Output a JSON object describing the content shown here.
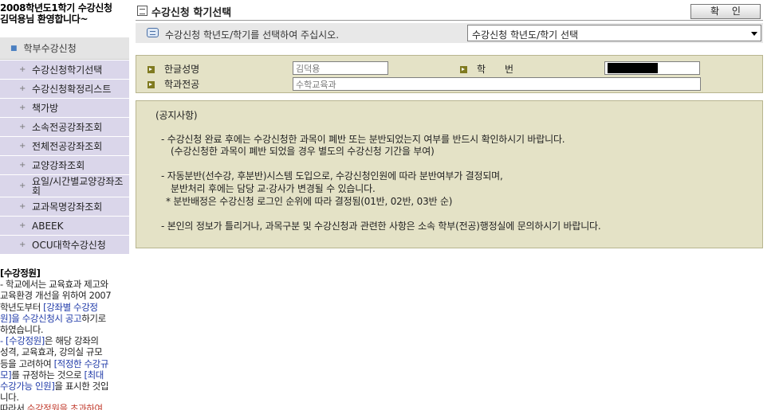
{
  "sidebar": {
    "welcome_line1": "2008학년도1학기 수강신청",
    "welcome_line2": "김덕용님 환영합니다~",
    "main_menu": "학부수강신청",
    "items": [
      {
        "label": "수강신청학기선택"
      },
      {
        "label": "수강신청확정리스트"
      },
      {
        "label": "책가방"
      },
      {
        "label": "소속전공강좌조회"
      },
      {
        "label": "전체전공강좌조회"
      },
      {
        "label": "교양강좌조회"
      },
      {
        "label": "요일/시간별교양강좌조회"
      },
      {
        "label": "교과목명강좌조회"
      },
      {
        "label": "ABEEK"
      },
      {
        "label": "OCU대학수강신청"
      }
    ],
    "notice": {
      "title": "[수강정원]",
      "l1": "- 학교에서는 교육효과 제고와",
      "l2": "교육환경 개선을 위하여 2007",
      "l3a": "학년도부터 ",
      "l3b": "[강좌별 수강정",
      "l4a": "원]을 수강신청시 공고",
      "l4b": "하기로",
      "l5": "하였습니다.",
      "l6a": "- [수강정원]",
      "l6b": "은 해당 강좌의",
      "l7": "성격, 교육효과, 강의실 규모",
      "l8a": "등을 고려하여 ",
      "l8b": "[적정한 수강규",
      "l9a": "모]",
      "l9b": "를 규정하는 것으로 ",
      "l9c": "[최대",
      "l10a": "수강가능 인원]",
      "l10b": "을 표시한 것입",
      "l11": "니다.",
      "l12a": "따라서 ",
      "l12b": "수강정원을 초과하여"
    }
  },
  "header": {
    "title": "수강신청 학기선택",
    "confirm_label": "확 인"
  },
  "instruction": {
    "text": "수강신청 학년도/학기를 선택하여 주십시오.",
    "select_value": "수강신청 학년도/학기 선택"
  },
  "student": {
    "name_label": "한글성명",
    "name_value": "김덕용",
    "id_label": "학　　번",
    "dept_label": "학과전공",
    "dept_value": "수학교육과"
  },
  "notice": {
    "heading": "(공지사항)",
    "line1": "- 수강신청 완료 후에는 수강신청한 과목이 폐반 또는 분반되었는지 여부를 반드시 확인하시기 바랍니다.",
    "line2": "(수강신청한 과목이 폐반 되었을 경우 별도의 수강신청 기간을 부여)",
    "line3": "- 자동분반(선수강, 후분반)시스템 도입으로, 수강신청인원에 따라 분반여부가 결정되며,",
    "line4": "분반처리 후에는 담당 교·강사가 변경될 수 있습니다.",
    "line5": "* 분반배정은 수강신청 로그인 순위에 따라 결정됨(01반, 02반, 03반 순)",
    "line6": "- 본인의 정보가 틀리거나, 과목구분 및 수강신청과 관련한 사항은 소속 학부(전공)행정실에 문의하시기 바랍니다."
  }
}
